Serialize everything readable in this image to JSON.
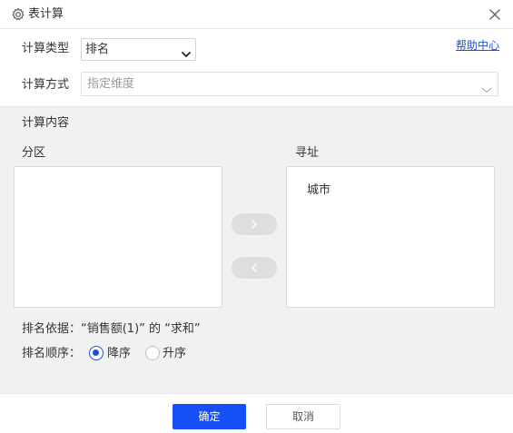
{
  "window": {
    "title": "表计算",
    "icon": "gear-icon",
    "close_icon": "close-icon"
  },
  "form": {
    "type_label": "计算类型",
    "type_value": "排名",
    "help_link": "帮助中心",
    "method_label": "计算方式",
    "method_placeholder": "指定维度"
  },
  "content": {
    "section_title": "计算内容",
    "partition_label": "分区",
    "partition_items": [],
    "addressing_label": "寻址",
    "addressing_items": [
      "城市"
    ],
    "basis_text": "排名依据：“销售额(1)” 的 “求和”",
    "order_label": "排名顺序：",
    "order_options": [
      {
        "label": "降序",
        "checked": true
      },
      {
        "label": "升序",
        "checked": false
      }
    ]
  },
  "footer": {
    "ok_label": "确定",
    "cancel_label": "取消"
  },
  "colors": {
    "accent": "#1450f5",
    "link": "#1a4fd6",
    "panel_bg": "#f1f1f1"
  }
}
